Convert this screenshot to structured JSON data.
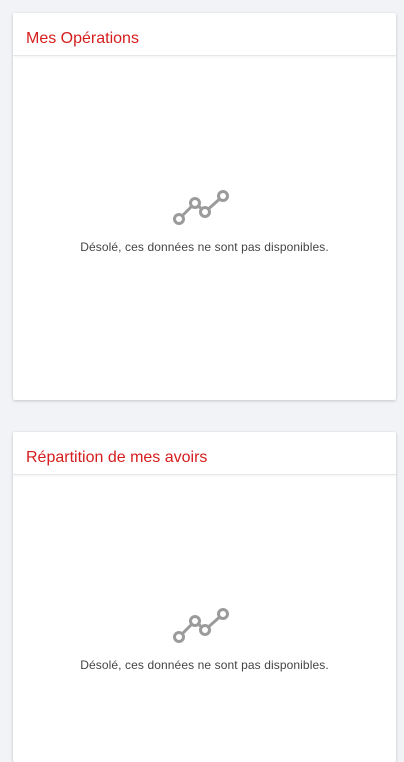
{
  "colors": {
    "page_background": "#f1f3f7",
    "card_background": "#ffffff",
    "title_red": "#d61d1d",
    "icon_gray": "#9b9b9b",
    "text_gray": "#444444"
  },
  "cards": [
    {
      "title": "Mes Opérations",
      "empty_icon": "line-chart-icon",
      "empty_message": "Désolé, ces données ne sont pas disponibles."
    },
    {
      "title": "Répartition de mes avoirs",
      "empty_icon": "line-chart-icon",
      "empty_message": "Désolé, ces données ne sont pas disponibles."
    }
  ]
}
